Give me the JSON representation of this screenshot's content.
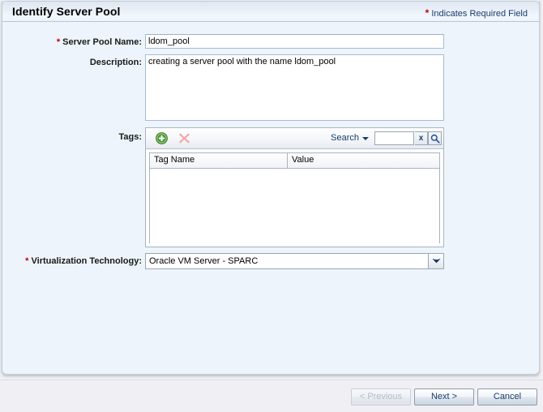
{
  "header": {
    "title": "Identify Server Pool",
    "required_note_star": "*",
    "required_note": "Indicates Required Field"
  },
  "form": {
    "pool_name": {
      "star": "*",
      "label": "Server Pool Name:",
      "value": "ldom_pool",
      "placeholder": ""
    },
    "description": {
      "label": "Description:",
      "value": "creating a server pool with the name ldom_pool",
      "placeholder": ""
    },
    "tags": {
      "label": "Tags:",
      "toolbar": {
        "add_icon": "add-circle-icon",
        "delete_icon": "delete-x-icon",
        "search_label": "Search",
        "search_caret_icon": "chevron-down-icon",
        "search_value": "",
        "search_placeholder": "",
        "clear_label": "x",
        "clear_icon": "clear-x-icon",
        "go_icon": "magnifier-icon"
      },
      "columns": [
        "Tag Name",
        "Value"
      ],
      "rows": []
    },
    "virtualization": {
      "star": "*",
      "label": "Virtualization Technology:",
      "selected": "Oracle VM Server - SPARC",
      "arrow_icon": "chevron-down-icon"
    }
  },
  "footer": {
    "previous_label": "< Previous",
    "next_label": "Next >",
    "cancel_label": "Cancel"
  },
  "colors": {
    "required_star": "#c00000",
    "link_text": "#1a3c6e",
    "panel_background": "#edf4fb",
    "add_icon_green": "#4a9a34",
    "delete_icon_pink": "#f2a3a3"
  }
}
